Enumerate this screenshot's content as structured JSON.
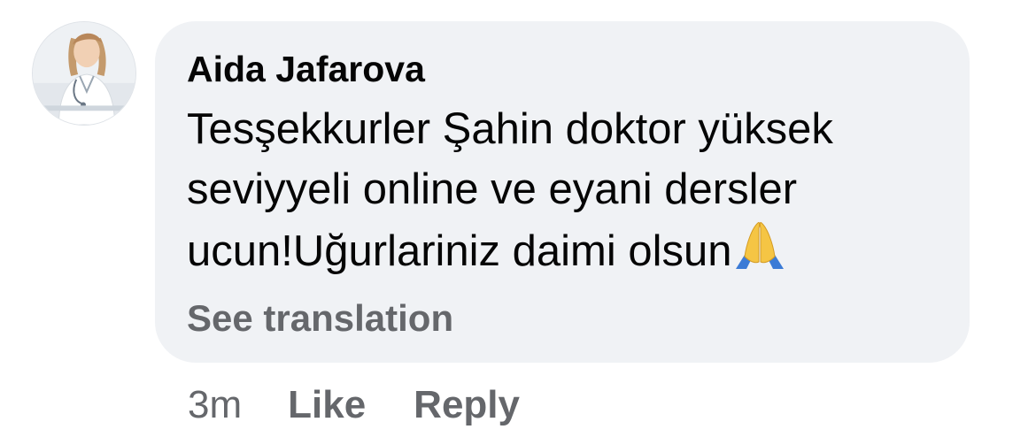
{
  "comment": {
    "author": "Aida Jafarova",
    "avatar_icon": "profile-photo-doctor",
    "text": "Tesşekkurler Şahin doktor yüksek seviyyeli online ve eyani dersler ucun!Uğurlariniz daimi olsun",
    "emoji": "🙏",
    "emoji_icon": "folded-hands-icon",
    "see_translation": "See translation",
    "bubble_color": "#f0f2f5"
  },
  "actions": {
    "time": "3m",
    "like": "Like",
    "reply": "Reply",
    "secondary_text_color": "#65676b"
  }
}
